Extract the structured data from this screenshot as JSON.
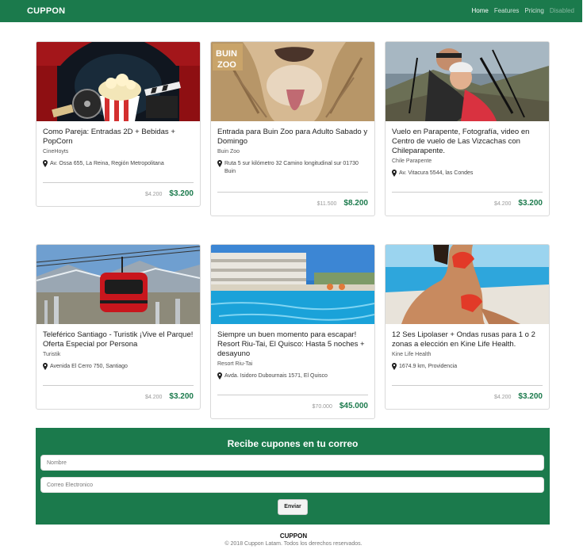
{
  "nav": {
    "brand": "CUPPON",
    "links": [
      {
        "label": "Home",
        "state": "active"
      },
      {
        "label": "Features",
        "state": "normal"
      },
      {
        "label": "Pricing",
        "state": "normal"
      },
      {
        "label": "Disabled",
        "state": "disabled"
      }
    ]
  },
  "cards": [
    {
      "title": "Como Pareja: Entradas 2D + Bebidas + PopCorn",
      "company": "CineHoyts",
      "address": "Av. Ossa 655, La Reina, Región Metropolitana",
      "old_price": "$4.200",
      "new_price": "$3.200",
      "image": "cinema-image"
    },
    {
      "title": "Entrada para Buin Zoo para Adulto Sabado y Domingo",
      "company": "Buin Zoo",
      "address": "Ruta 5 sur kilómetro 32 Camino longitudinal sur 01730 Buin",
      "old_price": "$11.500",
      "new_price": "$8.200",
      "image": "zoo-image"
    },
    {
      "title": "Vuelo en Parapente, Fotografía, video en Centro de vuelo de Las Vizcachas con Chileparapente.",
      "company": "Chile Parapente",
      "address": "Av. Vitacura 5544, las Condes",
      "old_price": "$4.200",
      "new_price": "$3.200",
      "image": "paraglide-image"
    },
    {
      "title": "Teleférico Santiago - Turistik ¡Vive el Parque! Oferta Especial por Persona",
      "company": "Turistik",
      "address": "Avenida El Cerro 750, Santiago",
      "old_price": "$4.200",
      "new_price": "$3.200",
      "image": "cablecar-image"
    },
    {
      "title": "Siempre un buen momento para escapar! Resort Riu-Tai, El Quisco: Hasta 5 noches + desayuno",
      "company": "Resort Riu-Tai",
      "address": "Avda. Isidoro Dubournais 1571, El Quisco",
      "old_price": "$70.000",
      "new_price": "$45.000",
      "image": "resort-image"
    },
    {
      "title": "12 Ses Lipolaser + Ondas rusas para 1 o 2 zonas a elección en Kine Life Health.",
      "company": "Kine Life Health",
      "address": "1674.9 km, Providencia",
      "old_price": "$4.200",
      "new_price": "$3.200",
      "image": "pool-image"
    }
  ],
  "newsletter": {
    "title": "Recibe cupones en tu correo",
    "name_placeholder": "Nombre",
    "email_placeholder": "Correo Electronico",
    "button": "Enviar"
  },
  "footer": {
    "brand": "CUPPON",
    "copyright": "© 2018 Cuppon Latam. Todos los derechos reservados."
  },
  "colors": {
    "primary": "#1b7a4c"
  }
}
